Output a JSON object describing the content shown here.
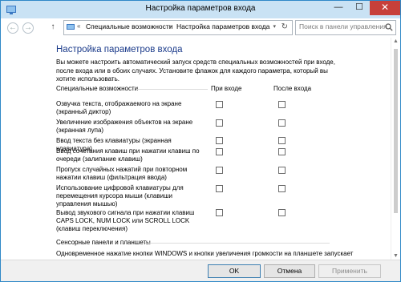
{
  "window": {
    "title": "Настройка параметров входа",
    "minimize_glyph": "—",
    "maximize_glyph": "☐",
    "close_glyph": "✕"
  },
  "nav": {
    "back_glyph": "←",
    "forward_glyph": "→",
    "up_glyph": "↑",
    "breadcrumb": [
      "«",
      "Специальные возможности",
      "›",
      "Настройка параметров входа"
    ],
    "dropdown_glyph": "▾",
    "refresh_glyph": "↻",
    "search_placeholder": "Поиск в панели управления"
  },
  "page": {
    "title": "Настройка параметров входа",
    "intro": "Вы можете настроить автоматический запуск средств специальных возможностей при входе, после входа или в обоих случаях. Установите флажок для каждого параметра, который вы хотите использовать.",
    "columns": {
      "feature": "Специальные возможности",
      "at_signin": "При входе",
      "after_signin": "После входа"
    },
    "features": [
      {
        "label": "Озвучка текста, отображаемого на экране (экранный диктор)",
        "at_signin": false,
        "after_signin": false
      },
      {
        "label": "Увеличение изображения объектов на экране (экранная лупа)",
        "at_signin": false,
        "after_signin": false
      },
      {
        "label": "Ввод текста без клавиатуры (экранная клавиатура)",
        "at_signin": false,
        "after_signin": false
      },
      {
        "label": "Ввод сочетания клавиш при нажатии клавиш по очереди (залипание клавиш)",
        "at_signin": false,
        "after_signin": false
      },
      {
        "label": "Пропуск случайных нажатий при повторном нажатии клавиш (фильтрация ввода)",
        "at_signin": false,
        "after_signin": false
      },
      {
        "label": "Использование цифровой клавиатуры для перемещения курсора мыши (клавиши управления мышью)",
        "at_signin": false,
        "after_signin": false
      },
      {
        "label": "Вывод звукового сигнала при нажатии клавиш CAPS LOCK, NUM LOCK или SCROLL LOCK (клавиш переключения)",
        "at_signin": false,
        "after_signin": false
      }
    ],
    "section2": {
      "heading": "Сенсорные панели и планшеты",
      "text": "Одновременное нажатие кнопки WINDOWS и кнопки увеличения громкости на планшете запускает"
    }
  },
  "scrollbar": {
    "up_glyph": "▲",
    "down_glyph": "▼"
  },
  "footer": {
    "ok": "OK",
    "cancel": "Отмена",
    "apply": "Применить"
  }
}
